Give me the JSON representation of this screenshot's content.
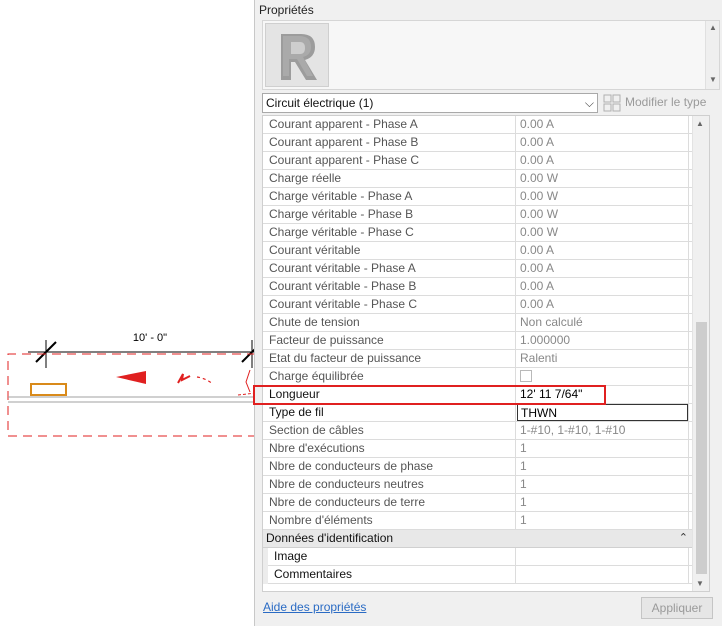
{
  "canvas": {
    "dimension_text": "10' - 0\""
  },
  "palette": {
    "title": "Propriétés",
    "type_selector": "Circuit électrique (1)",
    "edit_type_label": "Modifier le type",
    "help_link": "Aide des propriétés",
    "apply_label": "Appliquer"
  },
  "properties": [
    {
      "label": "Courant apparent - Phase A",
      "value": "0.00 A"
    },
    {
      "label": "Courant apparent - Phase B",
      "value": "0.00 A"
    },
    {
      "label": "Courant apparent - Phase C",
      "value": "0.00 A"
    },
    {
      "label": "Charge réelle",
      "value": "0.00 W"
    },
    {
      "label": "Charge véritable - Phase A",
      "value": "0.00 W"
    },
    {
      "label": "Charge véritable - Phase B",
      "value": "0.00 W"
    },
    {
      "label": "Charge véritable - Phase C",
      "value": "0.00 W"
    },
    {
      "label": "Courant véritable",
      "value": "0.00 A"
    },
    {
      "label": "Courant véritable - Phase A",
      "value": "0.00 A"
    },
    {
      "label": "Courant véritable - Phase B",
      "value": "0.00 A"
    },
    {
      "label": "Courant véritable - Phase C",
      "value": "0.00 A"
    },
    {
      "label": "Chute de tension",
      "value": "Non calculé"
    },
    {
      "label": "Facteur de puissance",
      "value": "1.000000"
    },
    {
      "label": "Etat du facteur de puissance",
      "value": "Ralenti"
    },
    {
      "label": "Charge équilibrée",
      "value": ""
    },
    {
      "label": "Longueur",
      "value": "12'  11 7/64\""
    },
    {
      "label": "Type de fil",
      "value": "THWN"
    },
    {
      "label": "Section de câbles",
      "value": "1-#10, 1-#10, 1-#10"
    },
    {
      "label": "Nbre d'exécutions",
      "value": "1"
    },
    {
      "label": "Nbre de conducteurs de phase",
      "value": "1"
    },
    {
      "label": "Nbre de conducteurs neutres",
      "value": "1"
    },
    {
      "label": "Nbre de conducteurs de terre",
      "value": "1"
    },
    {
      "label": "Nombre d'éléments",
      "value": "1"
    }
  ],
  "identity_group": {
    "title": "Données d'identification",
    "rows": [
      {
        "label": "Image",
        "value": ""
      },
      {
        "label": "Commentaires",
        "value": ""
      }
    ]
  },
  "colors": {
    "highlight": "#e02020",
    "link": "#2a6bc4",
    "circuit_red": "#e02020",
    "device_orange": "#d98a1a"
  }
}
